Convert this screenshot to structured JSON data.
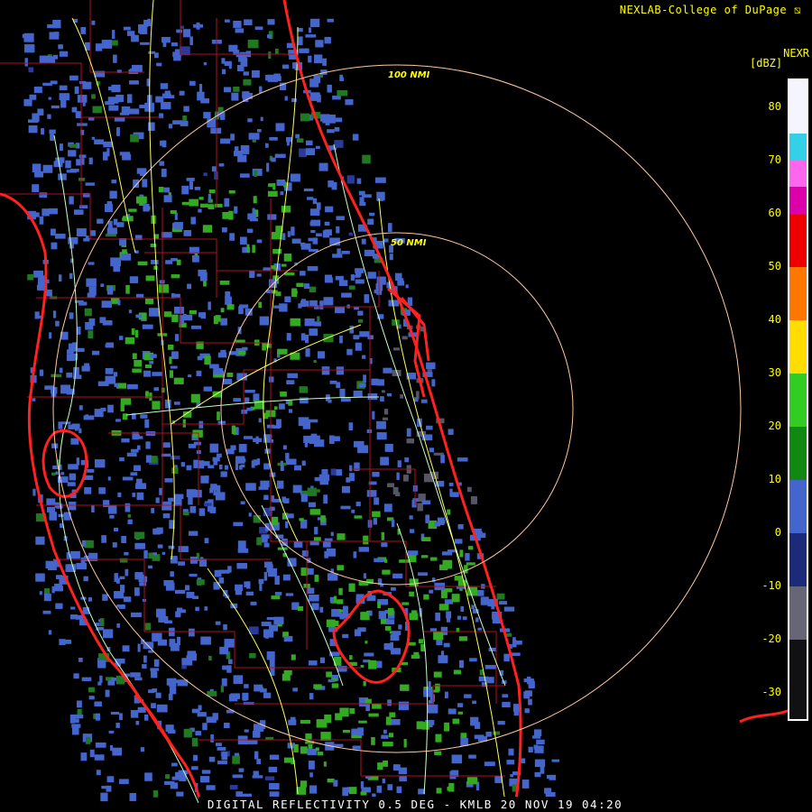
{
  "credit": "NEXLAB-College of DuPage",
  "credit_glyph": "⧅",
  "product": "NEXR",
  "unit": "[dBZ]",
  "footer": "DIGITAL REFLECTIVITY 0.5 DEG - KMLB 20 NOV 19 04:20",
  "rings": [
    {
      "label": "100 NMI",
      "radius_nmi": 100
    },
    {
      "label": "50 NMI",
      "radius_nmi": 50
    }
  ],
  "legend": {
    "ticks": [
      "80",
      "70",
      "60",
      "50",
      "40",
      "30",
      "20",
      "10",
      "0",
      "-10",
      "-20",
      "-30"
    ],
    "max_dbz": 85,
    "min_dbz": -35,
    "bands": [
      {
        "from": 75,
        "to": 85,
        "color": "#f5f5ff"
      },
      {
        "from": 70,
        "to": 75,
        "color": "#33d0e8"
      },
      {
        "from": 65,
        "to": 70,
        "color": "#ff66ee"
      },
      {
        "from": 60,
        "to": 65,
        "color": "#dd00aa"
      },
      {
        "from": 50,
        "to": 60,
        "color": "#ee0000"
      },
      {
        "from": 40,
        "to": 50,
        "color": "#ff7700"
      },
      {
        "from": 30,
        "to": 40,
        "color": "#ffdd00"
      },
      {
        "from": 20,
        "to": 30,
        "color": "#33cc22"
      },
      {
        "from": 10,
        "to": 20,
        "color": "#118811"
      },
      {
        "from": 0,
        "to": 10,
        "color": "#4466cc"
      },
      {
        "from": -10,
        "to": 0,
        "color": "#1c2a7a"
      },
      {
        "from": -20,
        "to": -10,
        "color": "#666677"
      },
      {
        "from": -35,
        "to": -20,
        "color": "#111114"
      }
    ]
  },
  "colors": {
    "county_lines": "#b01020",
    "coastline": "#ff2020",
    "roads": "#ffff60",
    "rivers": "#c8ffc8",
    "range_rings": "#ffc8a0"
  }
}
